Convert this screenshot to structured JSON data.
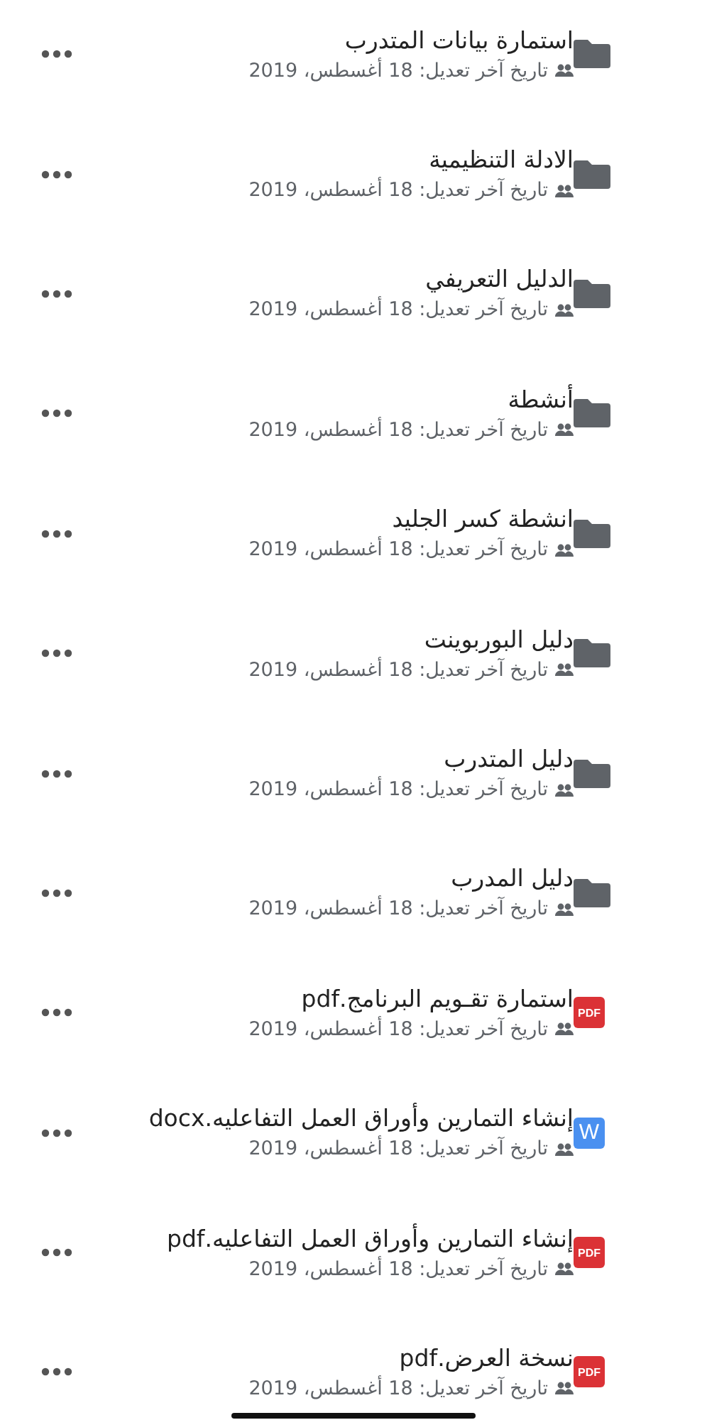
{
  "files": [
    {
      "kind": "folder",
      "name": "استمارة بيانات المتدرب",
      "modified": "تاريخ آخر تعديل: 18 أغسطس، 2019"
    },
    {
      "kind": "folder",
      "name": "الادلة التنظيمية",
      "modified": "تاريخ آخر تعديل: 18 أغسطس، 2019"
    },
    {
      "kind": "folder",
      "name": "الدليل التعريفي",
      "modified": "تاريخ آخر تعديل: 18 أغسطس، 2019"
    },
    {
      "kind": "folder",
      "name": "أنشطة",
      "modified": "تاريخ آخر تعديل: 18 أغسطس، 2019"
    },
    {
      "kind": "folder",
      "name": "انشطة كسر الجليد",
      "modified": "تاريخ آخر تعديل: 18 أغسطس، 2019"
    },
    {
      "kind": "folder",
      "name": "دليل البوربوينت",
      "modified": "تاريخ آخر تعديل: 18 أغسطس، 2019"
    },
    {
      "kind": "folder",
      "name": "دليل المتدرب",
      "modified": "تاريخ آخر تعديل: 18 أغسطس، 2019"
    },
    {
      "kind": "folder",
      "name": "دليل المدرب",
      "modified": "تاريخ آخر تعديل: 18 أغسطس، 2019"
    },
    {
      "kind": "pdf",
      "badge": "PDF",
      "name": "استمارة تقـويم البرنامج.pdf",
      "modified": "تاريخ آخر تعديل: 18 أغسطس، 2019"
    },
    {
      "kind": "word",
      "badge": "W",
      "name": "إنشاء التمارين وأوراق  العمل التفاعليه.docx",
      "modified": "تاريخ آخر تعديل: 18 أغسطس، 2019"
    },
    {
      "kind": "pdf",
      "badge": "PDF",
      "name": "إنشاء التمارين وأوراق  العمل التفاعليه.pdf",
      "modified": "تاريخ آخر تعديل: 18 أغسطس، 2019"
    },
    {
      "kind": "pdf",
      "badge": "PDF",
      "name": "نسخة العرض.pdf",
      "modified": "تاريخ آخر تعديل: 18 أغسطس، 2019"
    }
  ]
}
